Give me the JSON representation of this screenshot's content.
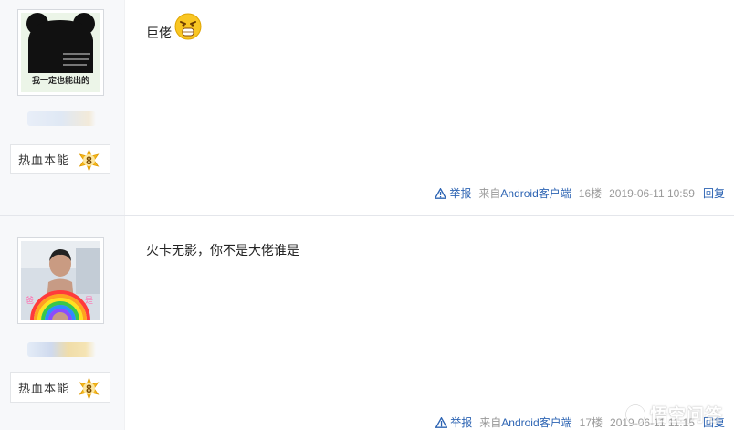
{
  "posts": [
    {
      "badge_label": "热血本能",
      "badge_level": "8",
      "avatar_caption": "我一定也能出的",
      "content_text": "巨佬",
      "footer": {
        "report": "举报",
        "from": "来自",
        "client": "Android客户端",
        "floor": "16楼",
        "time": "2019-06-11 10:59",
        "reply": "回复"
      }
    },
    {
      "badge_label": "热血本能",
      "badge_level": "8",
      "content_text": "火卡无影，你不是大佬谁是",
      "footer": {
        "report": "举报",
        "from": "来自",
        "client": "Android客户端",
        "floor": "17楼",
        "time": "2019-06-11 11:15",
        "reply": "回复"
      }
    }
  ],
  "watermark": "悟空问答",
  "colors": {
    "link": "#2d64b3",
    "meta": "#999999",
    "sidebar": "#f7f8fa",
    "badge_star": "#f5b81c"
  }
}
